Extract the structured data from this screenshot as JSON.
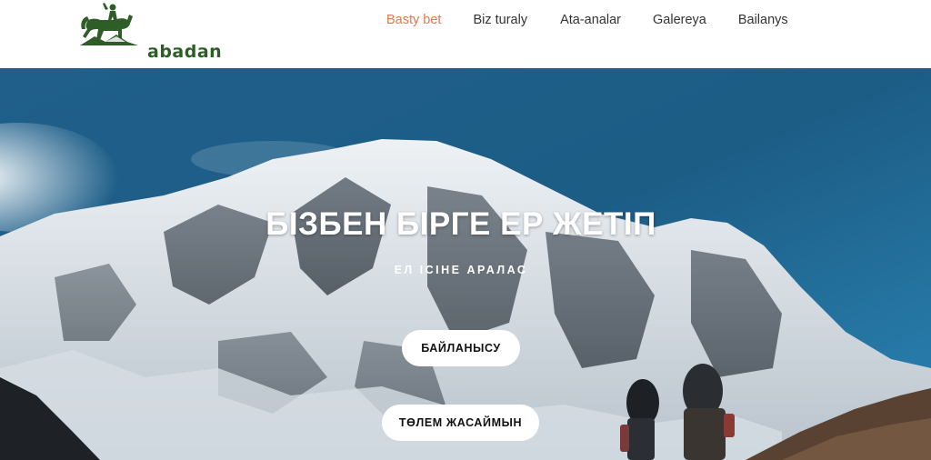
{
  "header": {
    "logo": {
      "text": "abadan",
      "icon": "horse-rider-icon",
      "color": "#2f5d28"
    },
    "nav": {
      "items": [
        {
          "label": "Basty bet",
          "active": true
        },
        {
          "label": "Biz turaly",
          "active": false
        },
        {
          "label": "Ata-analar",
          "active": false
        },
        {
          "label": "Galereya",
          "active": false
        },
        {
          "label": "Bailanys",
          "active": false
        }
      ],
      "active_color": "#e07a4d"
    }
  },
  "hero": {
    "title": "БІЗБЕН БІРГЕ ЕР ЖЕТІП",
    "subtitle": "ЕЛ ІСІНЕ АРАЛАС",
    "buttons": {
      "contact_label": "БАЙЛАНЫСУ",
      "pay_label": "ТӨЛЕМ ЖАСАЙМЫН"
    },
    "background": "mountain-hikers-image"
  }
}
